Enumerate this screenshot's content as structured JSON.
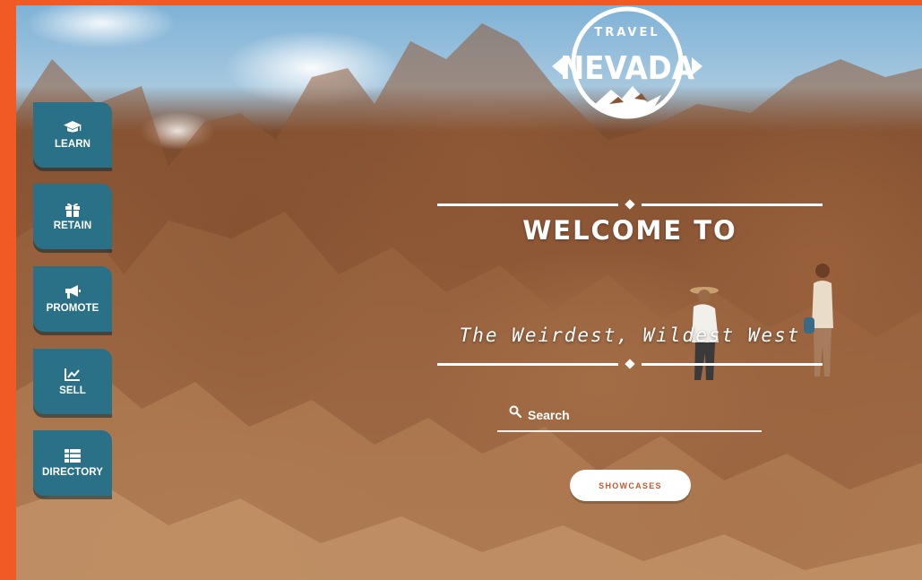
{
  "brand": {
    "logo_top": "TRAVEL",
    "logo_main": "NEVADA"
  },
  "hero": {
    "welcome": "WELCOME TO",
    "tagline": "The Weirdest, Wildest West"
  },
  "search": {
    "placeholder": "Search",
    "value": "",
    "icon": "search-icon"
  },
  "showcases_label": "SHOWCASES",
  "nav": {
    "items": [
      {
        "label": "LEARN",
        "icon": "graduation-cap-icon"
      },
      {
        "label": "RETAIN",
        "icon": "gift-icon"
      },
      {
        "label": "PROMOTE",
        "icon": "megaphone-icon"
      },
      {
        "label": "SELL",
        "icon": "chart-line-icon"
      },
      {
        "label": "DIRECTORY",
        "icon": "list-icon"
      }
    ]
  },
  "colors": {
    "frame": "#f15a24",
    "nav_button": "#2a7187",
    "showcases_text": "#c3592b"
  }
}
